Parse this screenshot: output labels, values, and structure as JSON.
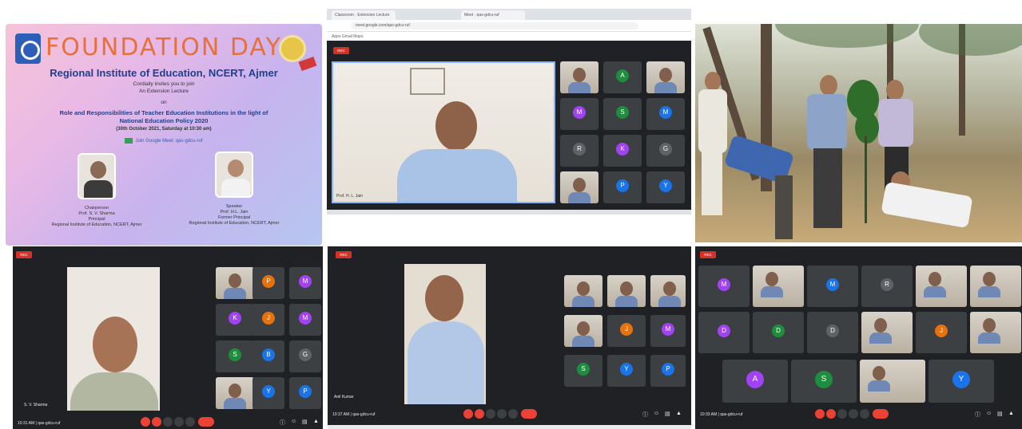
{
  "poster": {
    "title": "FOUNDATION DAY",
    "org": "Regional Institute of Education, NCERT, Ajmer",
    "invite1": "Cordially invites you to join",
    "invite2": "An Extension Lecture",
    "invite3": "on",
    "topic1": "Role and Responsibilities of Teacher Education Institutions in the light of",
    "topic2": "National Education Policy 2020",
    "date": "(30th October 2021, Saturday at 10:30 am)",
    "link": "Join Google Meet: qas-gdcu-ruf",
    "left_role": "Chairperson",
    "left_name": "Prof. S. V. Sharma",
    "left_title": "Principal",
    "left_org": "Regional Institute of Education, NCERT, Ajmer",
    "right_role": "Speaker",
    "right_name": "Prof. H.L. Jain",
    "right_title": "Former Principal",
    "right_org": "Regional Institute of Education, NCERT, Ajmer"
  },
  "meet_top": {
    "tab1": "Classroom · Extension Lecture",
    "tab2": "Meet · qas-gdcu-ruf",
    "url": "meet.google.com/qas-gdcu-ruf",
    "bookmarks": "Apps   Gmail   Maps",
    "rec_label": "REC",
    "speaker_name": "Prof. H. L. Jain",
    "tiles": [
      {
        "kind": "video",
        "name": ""
      },
      {
        "kind": "avatar",
        "letter": "A",
        "color": "#1e8e3e",
        "name": ""
      },
      {
        "kind": "video",
        "name": ""
      },
      {
        "kind": "avatar",
        "letter": "M",
        "color": "#a142f4",
        "name": ""
      },
      {
        "kind": "avatar",
        "letter": "S",
        "color": "#1e8e3e",
        "name": ""
      },
      {
        "kind": "avatar",
        "letter": "M",
        "color": "#1a73e8",
        "name": ""
      },
      {
        "kind": "avatar",
        "letter": "R",
        "color": "#5f6368",
        "name": ""
      },
      {
        "kind": "avatar",
        "letter": "K",
        "color": "#a142f4",
        "name": ""
      },
      {
        "kind": "avatar",
        "letter": "G",
        "color": "#5f6368",
        "name": ""
      },
      {
        "kind": "video",
        "name": ""
      },
      {
        "kind": "avatar",
        "letter": "P",
        "color": "#1a73e8",
        "name": ""
      },
      {
        "kind": "avatar",
        "letter": "Y",
        "color": "#1a73e8",
        "name": ""
      }
    ]
  },
  "meet_bl": {
    "rec_label": "REC",
    "speaker_name": "S. V. Sharma",
    "clock": "10:31 AM | qas-gdcu-ruf",
    "tiles": [
      {
        "kind": "video",
        "name": ""
      },
      {
        "kind": "avatar",
        "letter": "P",
        "color": "#e8710a",
        "name": ""
      },
      {
        "kind": "avatar",
        "letter": "M",
        "color": "#a142f4",
        "name": ""
      },
      {
        "kind": "avatar",
        "letter": "K",
        "color": "#a142f4",
        "name": ""
      },
      {
        "kind": "avatar",
        "letter": "J",
        "color": "#e8710a",
        "name": ""
      },
      {
        "kind": "avatar",
        "letter": "M",
        "color": "#a142f4",
        "name": ""
      },
      {
        "kind": "avatar",
        "letter": "S",
        "color": "#1e8e3e",
        "name": ""
      },
      {
        "kind": "avatar",
        "letter": "B",
        "color": "#1a73e8",
        "name": ""
      },
      {
        "kind": "avatar",
        "letter": "G",
        "color": "#5f6368",
        "name": ""
      },
      {
        "kind": "video",
        "name": ""
      },
      {
        "kind": "avatar",
        "letter": "Y",
        "color": "#1a73e8",
        "name": ""
      },
      {
        "kind": "avatar",
        "letter": "P",
        "color": "#1a73e8",
        "name": ""
      }
    ]
  },
  "meet_bm": {
    "rec_label": "REC",
    "speaker_name": "Anil Kumar",
    "clock": "10:37 AM | qas-gdcu-ruf",
    "tiles": [
      {
        "kind": "video",
        "name": ""
      },
      {
        "kind": "video",
        "name": ""
      },
      {
        "kind": "video",
        "name": ""
      },
      {
        "kind": "video",
        "name": ""
      },
      {
        "kind": "avatar",
        "letter": "J",
        "color": "#e8710a",
        "name": ""
      },
      {
        "kind": "avatar",
        "letter": "M",
        "color": "#a142f4",
        "name": ""
      },
      {
        "kind": "avatar",
        "letter": "S",
        "color": "#1e8e3e",
        "name": ""
      },
      {
        "kind": "avatar",
        "letter": "Y",
        "color": "#1a73e8",
        "name": ""
      },
      {
        "kind": "avatar",
        "letter": "P",
        "color": "#1a73e8",
        "name": ""
      }
    ]
  },
  "meet_br": {
    "rec_label": "REC",
    "clock": "10:33 AM | qas-gdcu-ruf",
    "tiles": [
      {
        "kind": "avatar",
        "letter": "M",
        "color": "#a142f4",
        "name": ""
      },
      {
        "kind": "video",
        "name": ""
      },
      {
        "kind": "avatar",
        "letter": "M",
        "color": "#1a73e8",
        "name": ""
      },
      {
        "kind": "avatar",
        "letter": "R",
        "color": "#5f6368",
        "name": ""
      },
      {
        "kind": "video",
        "name": ""
      },
      {
        "kind": "video",
        "name": ""
      },
      {
        "kind": "avatar",
        "letter": "D",
        "color": "#a142f4",
        "name": ""
      },
      {
        "kind": "avatar",
        "letter": "D",
        "color": "#1e8e3e",
        "name": ""
      },
      {
        "kind": "avatar",
        "letter": "D",
        "color": "#5f6368",
        "name": ""
      },
      {
        "kind": "video",
        "name": ""
      },
      {
        "kind": "avatar",
        "letter": "J",
        "color": "#e8710a",
        "name": ""
      },
      {
        "kind": "video",
        "name": ""
      },
      {
        "kind": "avatar",
        "letter": "A",
        "color": "#a142f4",
        "name": ""
      },
      {
        "kind": "avatar",
        "letter": "S",
        "color": "#1e8e3e",
        "name": ""
      },
      {
        "kind": "video",
        "name": ""
      },
      {
        "kind": "avatar",
        "letter": "Y",
        "color": "#1a73e8",
        "name": ""
      }
    ]
  }
}
